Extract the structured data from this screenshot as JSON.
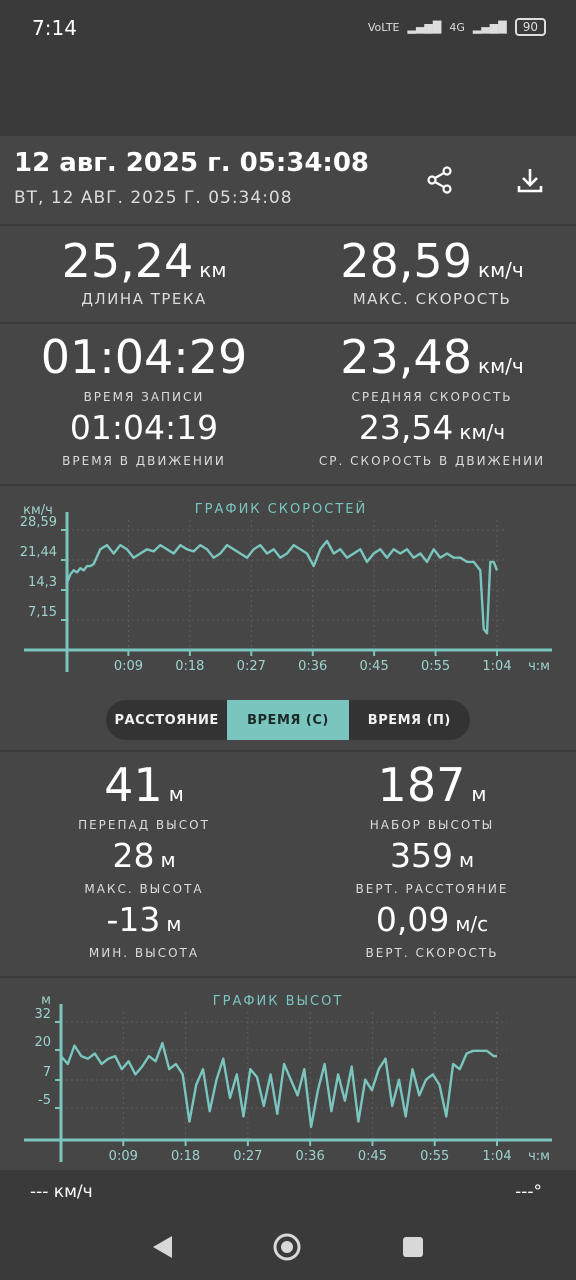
{
  "status": {
    "time": "7:14",
    "battery": "90",
    "net": "4G"
  },
  "header": {
    "title": "12 авг. 2025 г. 05:34:08",
    "subtitle": "ВТ, 12 АВГ. 2025 Г. 05:34:08"
  },
  "stats_top": {
    "length": {
      "value": "25,24",
      "unit": "км",
      "label": "ДЛИНА ТРЕКА"
    },
    "max_speed": {
      "value": "28,59",
      "unit": "км/ч",
      "label": "МАКС. СКОРОСТЬ"
    }
  },
  "stats_time": {
    "record_time": {
      "value": "01:04:29",
      "label": "ВРЕМЯ ЗАПИСИ"
    },
    "avg_speed": {
      "value": "23,48",
      "unit": "км/ч",
      "label": "СРЕДНЯЯ СКОРОСТЬ"
    },
    "moving_time": {
      "value": "01:04:19",
      "label": "ВРЕМЯ В ДВИЖЕНИИ"
    },
    "moving_avg_speed": {
      "value": "23,54",
      "unit": "км/ч",
      "label": "СР. СКОРОСТЬ В ДВИЖЕНИИ"
    }
  },
  "speed_chart": {
    "title": "ГРАФИК СКОРОСТЕЙ",
    "yunit": "км/ч",
    "xunit": "ч:м",
    "yticks": [
      "28,59",
      "21,44",
      "14,3",
      "7,15"
    ],
    "xticks": [
      "0:09",
      "0:18",
      "0:27",
      "0:36",
      "0:45",
      "0:55",
      "1:04"
    ]
  },
  "segments": {
    "distance": "РАССТОЯНИЕ",
    "time_c": "ВРЕМЯ (С)",
    "time_p": "ВРЕМЯ (П)"
  },
  "elev_stats": {
    "elev_diff": {
      "value": "41",
      "unit": "м",
      "label": "ПЕРЕПАД ВЫСОТ"
    },
    "elev_gain": {
      "value": "187",
      "unit": "м",
      "label": "НАБОР ВЫСОТЫ"
    },
    "max_alt": {
      "value": "28",
      "unit": "м",
      "label": "МАКС. ВЫСОТА"
    },
    "vert_dist": {
      "value": "359",
      "unit": "м",
      "label": "ВЕРТ. РАССТОЯНИЕ"
    },
    "min_alt": {
      "value": "-13",
      "unit": "м",
      "label": "МИН. ВЫСОТА"
    },
    "vert_speed": {
      "value": "0,09",
      "unit": "м/с",
      "label": "ВЕРТ. СКОРОСТЬ"
    }
  },
  "elev_chart": {
    "title": "ГРАФИК ВЫСОТ",
    "yunit": "м",
    "xunit": "ч:м",
    "yticks": [
      "32",
      "20",
      "7",
      "-5"
    ],
    "xticks": [
      "0:09",
      "0:18",
      "0:27",
      "0:36",
      "0:45",
      "0:55",
      "1:04"
    ]
  },
  "bottom": {
    "speed": "--- км/ч",
    "heading": "---°"
  },
  "colors": {
    "accent": "#7ac6bf",
    "card": "#464646",
    "background": "#3a3a3a"
  },
  "chart_data": [
    {
      "type": "line",
      "title": "ГРАФИК СКОРОСТЕЙ",
      "xlabel": "ч:м",
      "ylabel": "км/ч",
      "x": [
        0,
        0.5,
        1,
        1.5,
        2,
        2.5,
        3,
        3.5,
        4,
        5,
        6,
        7,
        8,
        9,
        10,
        11,
        12,
        13,
        14,
        15,
        16,
        17,
        18,
        19,
        20,
        21,
        22,
        23,
        24,
        25,
        26,
        27,
        28,
        29,
        30,
        31,
        32,
        33,
        34,
        35,
        36,
        37,
        38,
        39,
        40,
        41,
        42,
        43,
        44,
        45,
        46,
        47,
        48,
        49,
        50,
        51,
        52,
        53,
        54,
        55,
        56,
        57,
        58,
        59,
        60,
        61,
        61.5,
        62,
        62.5,
        63,
        63.5,
        64,
        64.5
      ],
      "values": [
        16,
        18,
        19,
        18.5,
        19.5,
        19,
        20,
        20,
        20.5,
        24,
        25,
        23,
        25,
        24,
        22,
        23,
        24,
        23.5,
        25,
        24,
        23,
        25,
        24,
        23.5,
        25,
        24,
        22,
        23,
        25,
        24,
        23,
        22,
        24,
        25,
        23,
        24,
        22,
        23,
        25,
        24,
        23,
        20,
        24,
        26,
        23,
        24,
        22,
        23,
        24,
        21,
        23,
        24,
        22,
        24,
        23,
        24,
        22,
        23,
        21,
        24,
        22,
        23,
        22,
        22,
        21,
        21,
        20,
        19,
        5,
        4,
        21,
        21,
        19
      ],
      "ylim": [
        0,
        28.59
      ],
      "grid": true
    },
    {
      "type": "line",
      "title": "ГРАФИК ВЫСОТ",
      "xlabel": "ч:м",
      "ylabel": "м",
      "x": [
        0,
        1,
        2,
        3,
        4,
        5,
        6,
        7,
        8,
        9,
        10,
        11,
        12,
        13,
        14,
        15,
        16,
        17,
        18,
        19,
        20,
        21,
        22,
        23,
        24,
        25,
        26,
        27,
        28,
        29,
        30,
        31,
        32,
        33,
        34,
        35,
        36,
        37,
        38,
        39,
        40,
        41,
        42,
        43,
        44,
        45,
        46,
        47,
        48,
        49,
        50,
        51,
        52,
        53,
        54,
        55,
        56,
        57,
        58,
        59,
        60,
        61,
        62,
        63,
        64,
        64.5
      ],
      "values": [
        19,
        16,
        23,
        19,
        18,
        20,
        16,
        18,
        19,
        14,
        17,
        12,
        15,
        19,
        17,
        24,
        14,
        16,
        12,
        -6,
        8,
        14,
        -2,
        10,
        18,
        3,
        12,
        -4,
        14,
        11,
        0,
        12,
        -3,
        16,
        10,
        4,
        14,
        -8,
        6,
        16,
        -2,
        12,
        2,
        15,
        -6,
        10,
        6,
        14,
        18,
        0,
        10,
        -4,
        14,
        4,
        10,
        12,
        8,
        -4,
        16,
        14,
        20,
        21,
        21,
        21,
        19,
        19
      ],
      "ylim": [
        -13,
        32
      ],
      "grid": true
    }
  ]
}
